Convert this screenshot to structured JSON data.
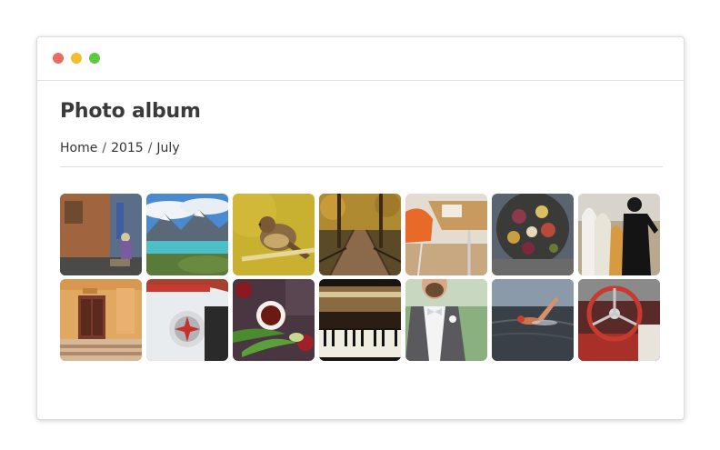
{
  "window": {
    "controls": [
      "close",
      "minimize",
      "maximize"
    ]
  },
  "page": {
    "title": "Photo album"
  },
  "breadcrumb": {
    "items": [
      "Home",
      "2015",
      "July"
    ],
    "separator": "/"
  },
  "album": {
    "photos": [
      {
        "subject": "old building street with cart"
      },
      {
        "subject": "mountain lake landscape"
      },
      {
        "subject": "yellow bird on branch"
      },
      {
        "subject": "boardwalk path through autumn forest"
      },
      {
        "subject": "orange chair at wooden desk"
      },
      {
        "subject": "food platter with figs"
      },
      {
        "subject": "surfer in wetsuit with surfboards"
      },
      {
        "subject": "yellow building doorway"
      },
      {
        "subject": "white classic car tail light"
      },
      {
        "subject": "tea cup with apples and tulips"
      },
      {
        "subject": "piano keys and hammers"
      },
      {
        "subject": "man in suit with bow tie"
      },
      {
        "subject": "swimmer in dark water"
      },
      {
        "subject": "red classic car steering wheel"
      }
    ]
  }
}
